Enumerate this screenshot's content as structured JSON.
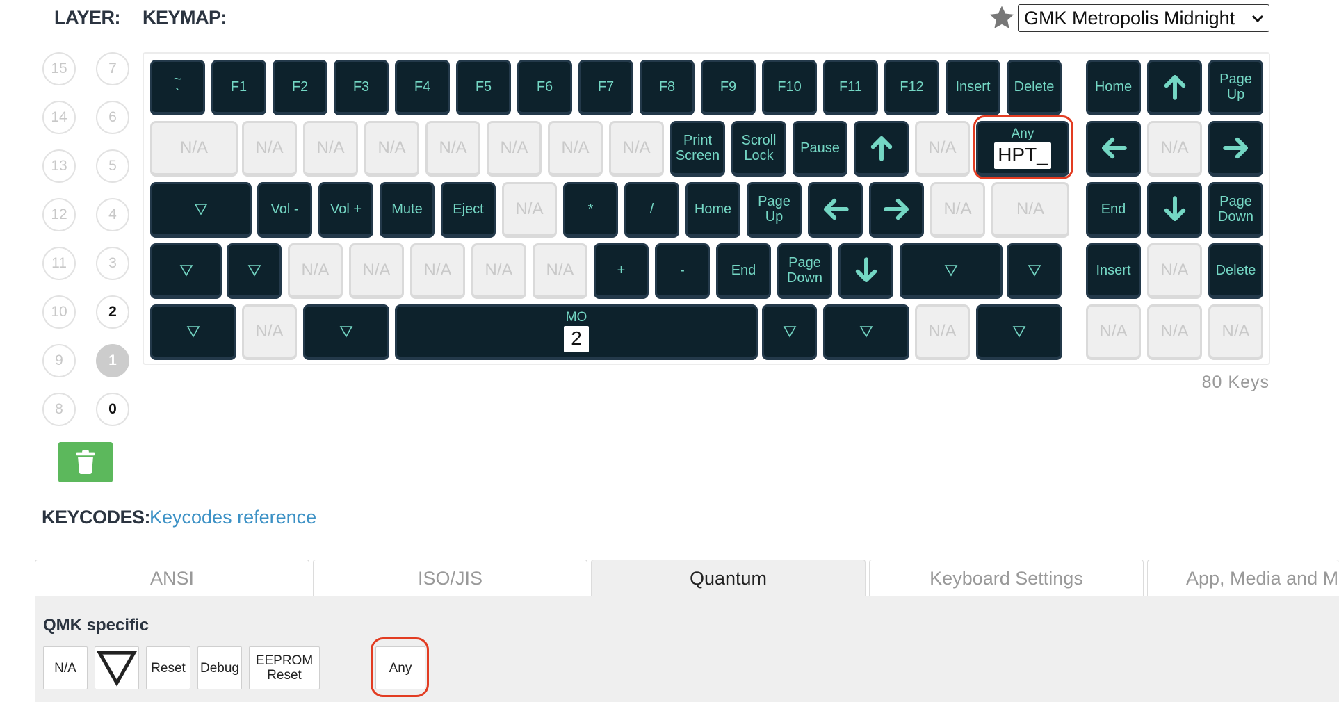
{
  "header": {
    "layer_label": "LAYER:",
    "keymap_label": "KEYMAP:"
  },
  "theme": {
    "icon": "star-icon",
    "selected": "GMK Metropolis Midnight"
  },
  "layers": [
    {
      "num": "15",
      "state": "empty"
    },
    {
      "num": "7",
      "state": "empty"
    },
    {
      "num": "14",
      "state": "empty"
    },
    {
      "num": "6",
      "state": "empty"
    },
    {
      "num": "13",
      "state": "empty"
    },
    {
      "num": "5",
      "state": "empty"
    },
    {
      "num": "12",
      "state": "empty"
    },
    {
      "num": "4",
      "state": "empty"
    },
    {
      "num": "11",
      "state": "empty"
    },
    {
      "num": "3",
      "state": "empty"
    },
    {
      "num": "10",
      "state": "empty"
    },
    {
      "num": "2",
      "state": "used"
    },
    {
      "num": "9",
      "state": "empty"
    },
    {
      "num": "1",
      "state": "active"
    },
    {
      "num": "8",
      "state": "empty"
    },
    {
      "num": "0",
      "state": "used"
    }
  ],
  "trash_icon": "trash-icon",
  "key_count": "80 Keys",
  "keycap_colors": {
    "dark": "#0d222c",
    "legend": "#74d7c4",
    "na": "#efefef",
    "highlight": "#e23c22",
    "trash": "#5cb85c"
  },
  "keys": [
    {
      "label": "~\n`"
    },
    {
      "label": "F1"
    },
    {
      "label": "F2"
    },
    {
      "label": "F3"
    },
    {
      "label": "F4"
    },
    {
      "label": "F5"
    },
    {
      "label": "F6"
    },
    {
      "label": "F7"
    },
    {
      "label": "F8"
    },
    {
      "label": "F9"
    },
    {
      "label": "F10"
    },
    {
      "label": "F11"
    },
    {
      "label": "F12"
    },
    {
      "label": "Insert"
    },
    {
      "label": "Delete"
    },
    {
      "label": "Home"
    },
    {
      "icon": "arrow-up"
    },
    {
      "label": "Page\nUp"
    },
    {
      "label": "N/A",
      "na": true
    },
    {
      "label": "N/A",
      "na": true
    },
    {
      "label": "N/A",
      "na": true
    },
    {
      "label": "N/A",
      "na": true
    },
    {
      "label": "N/A",
      "na": true
    },
    {
      "label": "N/A",
      "na": true
    },
    {
      "label": "N/A",
      "na": true
    },
    {
      "label": "N/A",
      "na": true
    },
    {
      "label": "Print\nScreen"
    },
    {
      "label": "Scroll\nLock"
    },
    {
      "label": "Pause"
    },
    {
      "icon": "arrow-up"
    },
    {
      "label": "N/A",
      "na": true
    },
    {
      "top": "Any",
      "box": "HPT_"
    },
    {
      "icon": "arrow-left"
    },
    {
      "label": "N/A",
      "na": true
    },
    {
      "icon": "arrow-right"
    },
    {
      "icon": "transparent"
    },
    {
      "label": "Vol -"
    },
    {
      "label": "Vol +"
    },
    {
      "label": "Mute"
    },
    {
      "label": "Eject"
    },
    {
      "label": "N/A",
      "na": true
    },
    {
      "label": "*"
    },
    {
      "label": "/"
    },
    {
      "label": "Home"
    },
    {
      "label": "Page\nUp"
    },
    {
      "icon": "arrow-left"
    },
    {
      "icon": "arrow-right"
    },
    {
      "label": "N/A",
      "na": true
    },
    {
      "label": "N/A",
      "na": true
    },
    {
      "label": "End"
    },
    {
      "icon": "arrow-down"
    },
    {
      "label": "Page\nDown"
    },
    {
      "icon": "transparent"
    },
    {
      "icon": "transparent"
    },
    {
      "label": "N/A",
      "na": true
    },
    {
      "label": "N/A",
      "na": true
    },
    {
      "label": "N/A",
      "na": true
    },
    {
      "label": "N/A",
      "na": true
    },
    {
      "label": "N/A",
      "na": true
    },
    {
      "label": "+"
    },
    {
      "label": "-"
    },
    {
      "label": "End"
    },
    {
      "label": "Page\nDown"
    },
    {
      "icon": "arrow-down"
    },
    {
      "icon": "transparent"
    },
    {
      "icon": "transparent"
    },
    {
      "label": "Insert"
    },
    {
      "label": "N/A",
      "na": true
    },
    {
      "label": "Delete"
    },
    {
      "icon": "transparent"
    },
    {
      "label": "N/A",
      "na": true
    },
    {
      "icon": "transparent"
    },
    {
      "top": "MO",
      "box": "2"
    },
    {
      "icon": "transparent"
    },
    {
      "icon": "transparent"
    },
    {
      "label": "N/A",
      "na": true
    },
    {
      "icon": "transparent"
    },
    {
      "label": "N/A",
      "na": true
    },
    {
      "label": "N/A",
      "na": true
    },
    {
      "label": "N/A",
      "na": true
    }
  ],
  "keycodes": {
    "title": "KEYCODES:",
    "link": "Keycodes reference"
  },
  "tabs": [
    {
      "label": "ANSI",
      "active": false
    },
    {
      "label": "ISO/JIS",
      "active": false
    },
    {
      "label": "Quantum",
      "active": true
    },
    {
      "label": "Keyboard Settings",
      "active": false
    },
    {
      "label": "App, Media and M",
      "active": false
    }
  ],
  "quantum": {
    "section_title": "QMK specific",
    "keycodes": [
      {
        "label": "N/A"
      },
      {
        "icon": "transparent"
      },
      {
        "label": "Reset"
      },
      {
        "label": "Debug"
      },
      {
        "label": "EEPROM\nReset"
      },
      {
        "label": "Any"
      }
    ]
  }
}
